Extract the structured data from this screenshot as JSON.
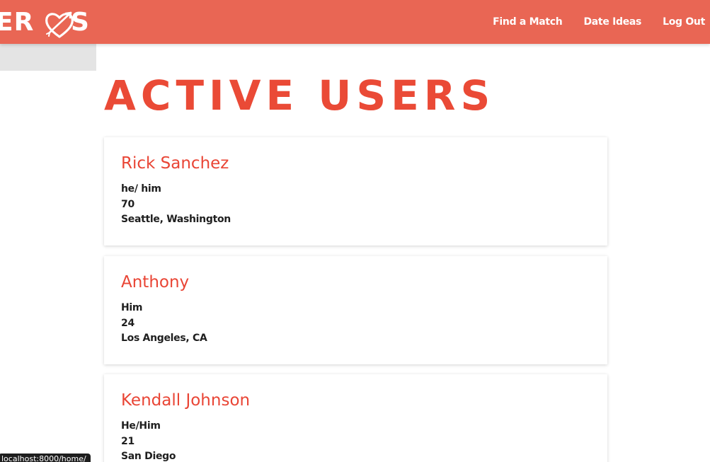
{
  "brand": {
    "logo_left": "ER",
    "logo_right": "S",
    "heart_icon": "heart-arrow-icon"
  },
  "nav": {
    "links": [
      {
        "label": "Find a Match"
      },
      {
        "label": "Date Ideas"
      },
      {
        "label": "Log Out"
      }
    ]
  },
  "page": {
    "title": "Active Users"
  },
  "users": [
    {
      "name": "Rick Sanchez",
      "pronouns": "he/ him",
      "age": "70",
      "location": "Seattle, Washington"
    },
    {
      "name": "Anthony",
      "pronouns": "Him",
      "age": "24",
      "location": "Los Angeles, CA"
    },
    {
      "name": "Kendall Johnson",
      "pronouns": "He/Him",
      "age": "21",
      "location": "San Diego"
    }
  ],
  "status_bar": {
    "url": "localhost:8000/home/"
  },
  "colors": {
    "navbar": "#e96654",
    "accent": "#ea4a36",
    "logo_box": "#e4e4e4"
  }
}
